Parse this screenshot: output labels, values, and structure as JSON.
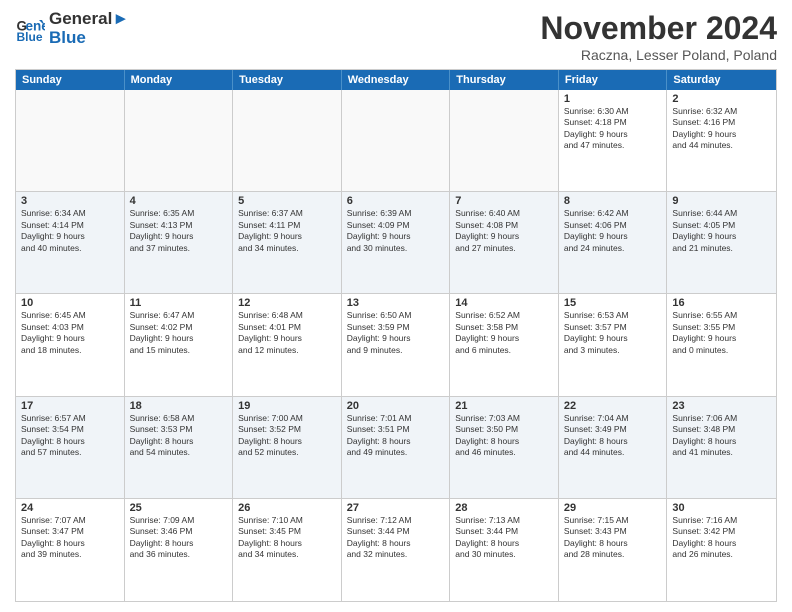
{
  "logo": {
    "line1": "General",
    "line2": "Blue"
  },
  "title": "November 2024",
  "location": "Raczna, Lesser Poland, Poland",
  "header_days": [
    "Sunday",
    "Monday",
    "Tuesday",
    "Wednesday",
    "Thursday",
    "Friday",
    "Saturday"
  ],
  "weeks": [
    [
      {
        "day": "",
        "info": ""
      },
      {
        "day": "",
        "info": ""
      },
      {
        "day": "",
        "info": ""
      },
      {
        "day": "",
        "info": ""
      },
      {
        "day": "",
        "info": ""
      },
      {
        "day": "1",
        "info": "Sunrise: 6:30 AM\nSunset: 4:18 PM\nDaylight: 9 hours\nand 47 minutes."
      },
      {
        "day": "2",
        "info": "Sunrise: 6:32 AM\nSunset: 4:16 PM\nDaylight: 9 hours\nand 44 minutes."
      }
    ],
    [
      {
        "day": "3",
        "info": "Sunrise: 6:34 AM\nSunset: 4:14 PM\nDaylight: 9 hours\nand 40 minutes."
      },
      {
        "day": "4",
        "info": "Sunrise: 6:35 AM\nSunset: 4:13 PM\nDaylight: 9 hours\nand 37 minutes."
      },
      {
        "day": "5",
        "info": "Sunrise: 6:37 AM\nSunset: 4:11 PM\nDaylight: 9 hours\nand 34 minutes."
      },
      {
        "day": "6",
        "info": "Sunrise: 6:39 AM\nSunset: 4:09 PM\nDaylight: 9 hours\nand 30 minutes."
      },
      {
        "day": "7",
        "info": "Sunrise: 6:40 AM\nSunset: 4:08 PM\nDaylight: 9 hours\nand 27 minutes."
      },
      {
        "day": "8",
        "info": "Sunrise: 6:42 AM\nSunset: 4:06 PM\nDaylight: 9 hours\nand 24 minutes."
      },
      {
        "day": "9",
        "info": "Sunrise: 6:44 AM\nSunset: 4:05 PM\nDaylight: 9 hours\nand 21 minutes."
      }
    ],
    [
      {
        "day": "10",
        "info": "Sunrise: 6:45 AM\nSunset: 4:03 PM\nDaylight: 9 hours\nand 18 minutes."
      },
      {
        "day": "11",
        "info": "Sunrise: 6:47 AM\nSunset: 4:02 PM\nDaylight: 9 hours\nand 15 minutes."
      },
      {
        "day": "12",
        "info": "Sunrise: 6:48 AM\nSunset: 4:01 PM\nDaylight: 9 hours\nand 12 minutes."
      },
      {
        "day": "13",
        "info": "Sunrise: 6:50 AM\nSunset: 3:59 PM\nDaylight: 9 hours\nand 9 minutes."
      },
      {
        "day": "14",
        "info": "Sunrise: 6:52 AM\nSunset: 3:58 PM\nDaylight: 9 hours\nand 6 minutes."
      },
      {
        "day": "15",
        "info": "Sunrise: 6:53 AM\nSunset: 3:57 PM\nDaylight: 9 hours\nand 3 minutes."
      },
      {
        "day": "16",
        "info": "Sunrise: 6:55 AM\nSunset: 3:55 PM\nDaylight: 9 hours\nand 0 minutes."
      }
    ],
    [
      {
        "day": "17",
        "info": "Sunrise: 6:57 AM\nSunset: 3:54 PM\nDaylight: 8 hours\nand 57 minutes."
      },
      {
        "day": "18",
        "info": "Sunrise: 6:58 AM\nSunset: 3:53 PM\nDaylight: 8 hours\nand 54 minutes."
      },
      {
        "day": "19",
        "info": "Sunrise: 7:00 AM\nSunset: 3:52 PM\nDaylight: 8 hours\nand 52 minutes."
      },
      {
        "day": "20",
        "info": "Sunrise: 7:01 AM\nSunset: 3:51 PM\nDaylight: 8 hours\nand 49 minutes."
      },
      {
        "day": "21",
        "info": "Sunrise: 7:03 AM\nSunset: 3:50 PM\nDaylight: 8 hours\nand 46 minutes."
      },
      {
        "day": "22",
        "info": "Sunrise: 7:04 AM\nSunset: 3:49 PM\nDaylight: 8 hours\nand 44 minutes."
      },
      {
        "day": "23",
        "info": "Sunrise: 7:06 AM\nSunset: 3:48 PM\nDaylight: 8 hours\nand 41 minutes."
      }
    ],
    [
      {
        "day": "24",
        "info": "Sunrise: 7:07 AM\nSunset: 3:47 PM\nDaylight: 8 hours\nand 39 minutes."
      },
      {
        "day": "25",
        "info": "Sunrise: 7:09 AM\nSunset: 3:46 PM\nDaylight: 8 hours\nand 36 minutes."
      },
      {
        "day": "26",
        "info": "Sunrise: 7:10 AM\nSunset: 3:45 PM\nDaylight: 8 hours\nand 34 minutes."
      },
      {
        "day": "27",
        "info": "Sunrise: 7:12 AM\nSunset: 3:44 PM\nDaylight: 8 hours\nand 32 minutes."
      },
      {
        "day": "28",
        "info": "Sunrise: 7:13 AM\nSunset: 3:44 PM\nDaylight: 8 hours\nand 30 minutes."
      },
      {
        "day": "29",
        "info": "Sunrise: 7:15 AM\nSunset: 3:43 PM\nDaylight: 8 hours\nand 28 minutes."
      },
      {
        "day": "30",
        "info": "Sunrise: 7:16 AM\nSunset: 3:42 PM\nDaylight: 8 hours\nand 26 minutes."
      }
    ]
  ]
}
